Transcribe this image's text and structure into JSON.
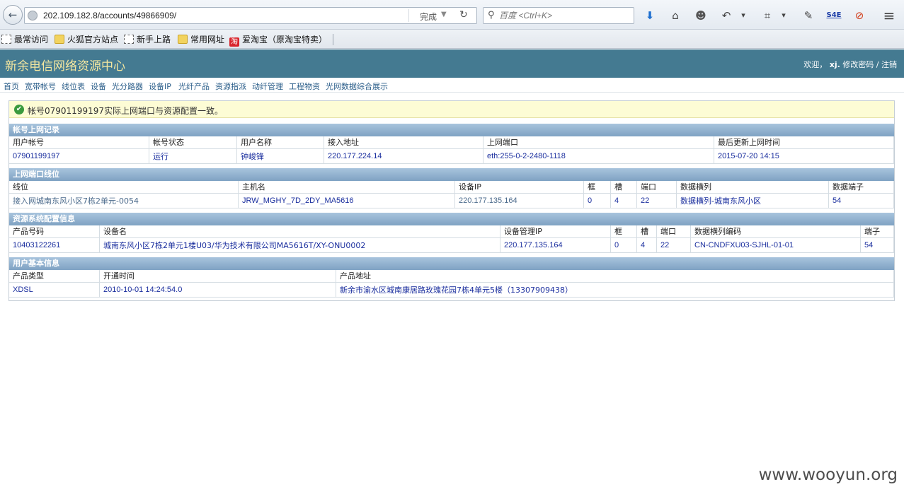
{
  "browser": {
    "url": "202.109.182.8/accounts/49866909/",
    "status": "完成",
    "search_placeholder": "百度 <Ctrl+K>",
    "back_glyph": "←",
    "reload_glyph": "↻",
    "dropdown_glyph": "▼",
    "toolbar_icons": [
      {
        "name": "download-icon",
        "glyph": "⬇",
        "color": "#1e6fd0"
      },
      {
        "name": "home-icon",
        "glyph": "⌂",
        "color": "#444444"
      },
      {
        "name": "smiley-icon",
        "glyph": "☻",
        "color": "#555555"
      },
      {
        "name": "undo-icon",
        "glyph": "↶",
        "color": "#444444"
      },
      {
        "name": "menu-dropdown-icon",
        "glyph": "▾",
        "color": "#444444"
      },
      {
        "name": "crop-icon",
        "glyph": "⌗",
        "color": "#444444"
      },
      {
        "name": "crop-dropdown-icon",
        "glyph": "▾",
        "color": "#444444"
      },
      {
        "name": "chat-icon",
        "glyph": "✎",
        "color": "#444444"
      },
      {
        "name": "s4e-icon",
        "glyph": "S4E",
        "color": "#1e3fa8"
      },
      {
        "name": "blocked-icon",
        "glyph": "⊘",
        "color": "#d23d1a"
      },
      {
        "name": "hamburger-menu-icon",
        "glyph": "≡",
        "color": "#444444"
      }
    ]
  },
  "bookmarks": [
    {
      "label": "最常访问",
      "icon": "dotted"
    },
    {
      "label": "火狐官方站点",
      "icon": "folder"
    },
    {
      "label": "新手上路",
      "icon": "dotted"
    },
    {
      "label": "常用网址",
      "icon": "folder"
    },
    {
      "label": "爱淘宝（原淘宝特卖）",
      "icon": "tao"
    }
  ],
  "bookmark_tao_glyph": "淘",
  "header": {
    "title": "新余电信网络资源中心",
    "welcome": "欢迎，",
    "user": "xj.",
    "change_password": "修改密码",
    "separator": "/",
    "logout": "注销"
  },
  "menu": [
    "首页",
    "宽带帐号",
    "线位表",
    "设备",
    "光分路器",
    "设备IP",
    "光纤产品",
    "资源指派",
    "动纤管理",
    "工程物资",
    "光网数据综合展示"
  ],
  "notice": {
    "icon_glyph": "✔",
    "text": "帐号07901199197实际上网端口与资源配置一致。"
  },
  "sections": {
    "online_record": {
      "title": "帐号上网记录",
      "headers": [
        "用户帐号",
        "帐号状态",
        "用户名称",
        "接入地址",
        "上网端口",
        "最后更新上网时间"
      ],
      "values": [
        "07901199197",
        "运行",
        "钟峻锋",
        "220.177.224.14",
        "eth:255-0-2-2480-1118",
        "2015-07-20 14:15"
      ]
    },
    "port_line": {
      "title": "上网端口线位",
      "headers": [
        "线位",
        "主机名",
        "设备IP",
        "框",
        "槽",
        "端口",
        "数据横列",
        "数据端子"
      ],
      "values": [
        "接入网城南东风小区7栋2单元-0054",
        "JRW_MGHY_7D_2DY_MA5616",
        "220.177.135.164",
        "0",
        "4",
        "22",
        "数据横列-城南东风小区",
        "54"
      ]
    },
    "resource_config": {
      "title": "资源系统配置信息",
      "headers": [
        "产品号码",
        "设备名",
        "设备管理IP",
        "框",
        "槽",
        "端口",
        "数据横列编码",
        "端子"
      ],
      "values": [
        "10403122261",
        "城南东风小区7栋2单元1楼U03/华为技术有限公司MA5616T/XY-ONU0002",
        "220.177.135.164",
        "0",
        "4",
        "22",
        "CN-CNDFXU03-SJHL-01-01",
        "54"
      ]
    },
    "user_basic": {
      "title": "用户基本信息",
      "headers": [
        "产品类型",
        "开通时间",
        "产品地址"
      ],
      "values": [
        "XDSL",
        "2010-10-01 14:24:54.0",
        "新余市渝水区城南康居路玫瑰花园7栋4单元5楼（13307909438）"
      ]
    }
  },
  "watermark": "www.wooyun.org"
}
